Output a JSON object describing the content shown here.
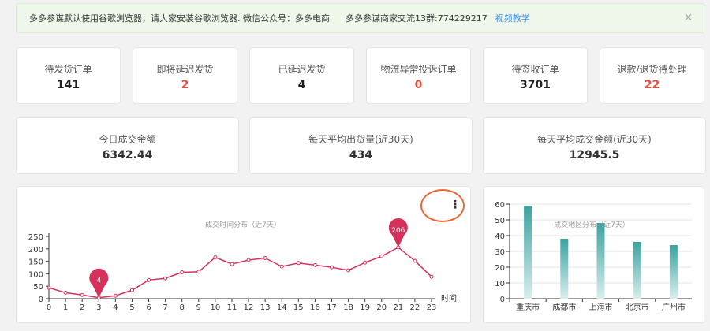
{
  "notice": {
    "text1": "多多参谋默认使用谷歌浏览器，请大家安装谷歌浏览器. 微信公众号：多多电商",
    "text2": "多多参谋商家交流13群:774229217",
    "link": "视频教学",
    "close": "×"
  },
  "stats_row1": [
    {
      "label": "待发货订单",
      "value": "141",
      "color": "#222222"
    },
    {
      "label": "即将延迟发货",
      "value": "2",
      "color": "#e74c3c"
    },
    {
      "label": "已延迟发货",
      "value": "4",
      "color": "#222222"
    },
    {
      "label": "物流异常投诉订单",
      "value": "0",
      "color": "#e74c3c"
    },
    {
      "label": "待签收订单",
      "value": "3701",
      "color": "#222222"
    },
    {
      "label": "退款/退货待处理",
      "value": "22",
      "color": "#e74c3c"
    }
  ],
  "stats_row2": [
    {
      "label": "今日成交金额",
      "value": "6342.44"
    },
    {
      "label": "每天平均出货量(近30天)",
      "value": "434"
    },
    {
      "label": "每天平均成交金额(近30天)",
      "value": "12945.5"
    }
  ],
  "chart_data": [
    {
      "type": "line",
      "title": "成交时间分布（近7天）",
      "xlabel": "时间",
      "ylabel": "",
      "x": [
        0,
        1,
        2,
        3,
        4,
        5,
        6,
        7,
        8,
        9,
        10,
        11,
        12,
        13,
        14,
        15,
        16,
        17,
        18,
        19,
        20,
        21,
        22,
        23
      ],
      "values": [
        44,
        24,
        15,
        4,
        12,
        34,
        75,
        82,
        106,
        108,
        166,
        139,
        155,
        163,
        129,
        143,
        135,
        126,
        114,
        145,
        170,
        206,
        152,
        88
      ],
      "ylim": [
        0,
        250
      ],
      "yticks": [
        0,
        50,
        100,
        150,
        200,
        250
      ],
      "markers": [
        {
          "label": "206",
          "index": 21,
          "color": "#d5315a"
        },
        {
          "label": "4",
          "index": 3,
          "color": "#d5315a"
        }
      ],
      "color": "#d5315a",
      "grid": false
    },
    {
      "type": "bar",
      "title": "成交地区分布（近7天）",
      "categories": [
        "重庆市",
        "成都市",
        "上海市",
        "北京市",
        "广州市"
      ],
      "values": [
        59,
        38,
        48,
        36,
        34
      ],
      "ylim": [
        0,
        60
      ],
      "yticks": [
        0,
        10,
        20,
        30,
        40,
        50,
        60
      ],
      "color": "#3aa3a0",
      "grid": true
    }
  ],
  "menu_icon": "more-vertical-icon",
  "menu_glyph": "⋮"
}
